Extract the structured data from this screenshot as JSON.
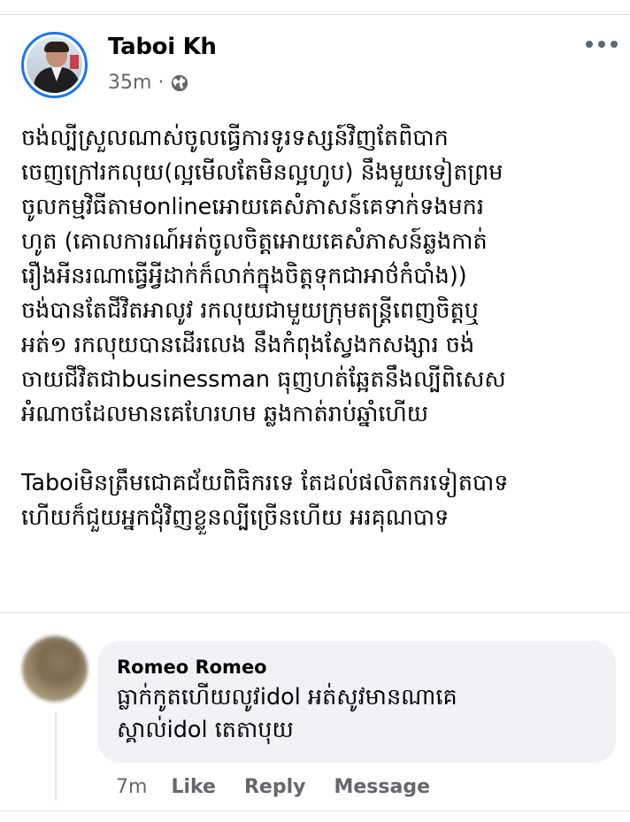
{
  "post": {
    "author": "Taboi Kh",
    "time": "35m",
    "separator": "·",
    "privacy_icon": "globe-icon",
    "paragraphs": [
      "ចង់ល្បីស្រួលណាស់ចូលធ្វើការទូរទស្សន៍វិញតែពិបាក\nចេញក្រៅរកលុយ(ល្អមើលតែមិនល្អហូប) នឹងមួយទៀតព្រម\nចូលកម្មវិធីតាមonlineអោយគេសំភាសន៍គេទាក់ទងមករ\nហូត (គោលការណ៍អត់ចូលចិត្តអោយគេសំភាសន៍ឆ្លងកាត់\nរឿងអីនរណាធ្វើអ្វីដាក់ក៏លាក់ក្នុងចិត្តទុកជាអាថ៌កំបាំង))\nចង់បានតែជីវិតអាលូវ រកលុយជាមួយក្រុមតន្ត្រីពេញចិត្តឬ\nអត់១ រកលុយបានដើរលេង នឹងកំពុងស្វែងកសង្សារ ចង់\nចាយជីវិតជាbusinessman ធុញហត់ឆ្អែតនឹងល្បីពិសេស\nអំណាចដែលមានគេហែរហម ឆ្លងកាត់រាប់ឆ្នាំហើយ",
      "Taboiមិនត្រឹមជោគជ័យពិធិករទេ តែដល់ផលិតករទៀតបាទ\nហើយក៏ជួយអ្នកជុំវិញខ្លួនល្បីច្រើនហើយ អរគុណបាទ"
    ]
  },
  "comment": {
    "author": "Romeo Romeo",
    "text": "ធ្លាក់កូតហើយលូវidol អត់សូវមានណាគេ\nស្គាល់idol តេតាបុយ",
    "time": "7m",
    "actions": [
      "Like",
      "Reply",
      "Message"
    ]
  }
}
